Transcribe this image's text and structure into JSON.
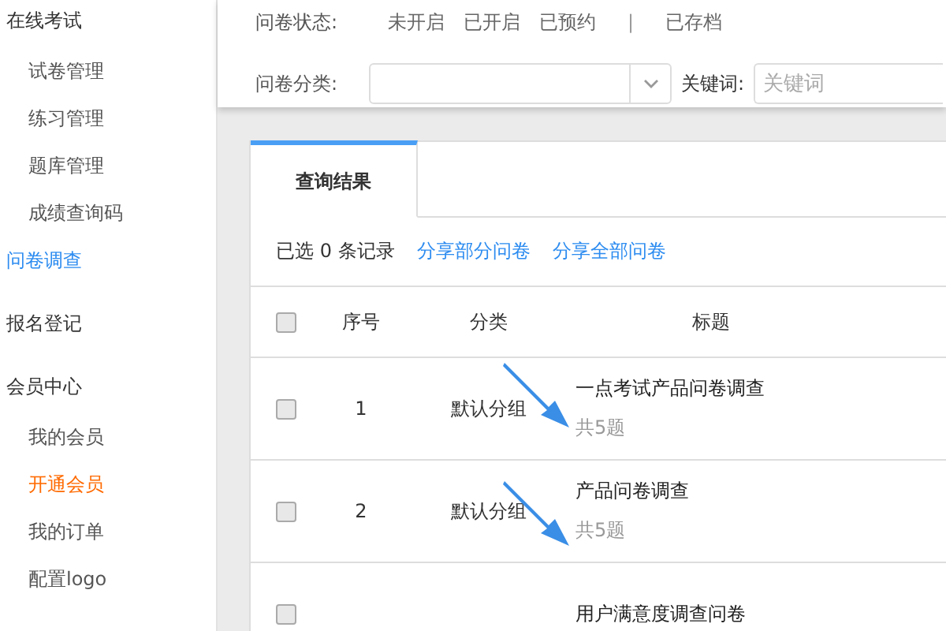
{
  "sidebar": {
    "groups": [
      {
        "label": "在线考试",
        "selected": false,
        "children": [
          {
            "label": "试卷管理",
            "selected": false,
            "highlight": false
          },
          {
            "label": "练习管理",
            "selected": false,
            "highlight": false
          },
          {
            "label": "题库管理",
            "selected": false,
            "highlight": false
          },
          {
            "label": "成绩查询码",
            "selected": false,
            "highlight": false
          }
        ]
      },
      {
        "label": "问卷调查",
        "selected": true
      },
      {
        "label": "报名登记",
        "selected": false
      },
      {
        "label": "会员中心",
        "selected": false,
        "children": [
          {
            "label": "我的会员",
            "selected": false,
            "highlight": false
          },
          {
            "label": "开通会员",
            "selected": false,
            "highlight": true
          },
          {
            "label": "我的订单",
            "selected": false,
            "highlight": false
          },
          {
            "label": "配置logo",
            "selected": false,
            "highlight": false
          }
        ]
      }
    ]
  },
  "filters": {
    "status_label": "问卷状态:",
    "statuses": [
      {
        "kind": "option",
        "label": "未开启"
      },
      {
        "kind": "option",
        "label": "已开启"
      },
      {
        "kind": "option",
        "label": "已预约"
      },
      {
        "kind": "divider",
        "label": "|"
      },
      {
        "kind": "option",
        "label": "已存档"
      }
    ],
    "category_label": "问卷分类:",
    "keyword_label": "关键词:",
    "keyword_placeholder": "关键词"
  },
  "tabs": [
    {
      "label": "查询结果",
      "selected": true
    }
  ],
  "toolbar": {
    "selected_count": "已选 0 条记录",
    "links": [
      "分享部分问卷",
      "分享全部问卷"
    ]
  },
  "table": {
    "select_all_checked": false,
    "columns": [
      "序号",
      "分类",
      "标题"
    ],
    "rows": [
      {
        "checked": false,
        "index": "1",
        "category": "默认分组",
        "title": "一点考试产品问卷调查",
        "count": "共5题"
      },
      {
        "checked": false,
        "index": "2",
        "category": "默认分组",
        "title": "产品问卷调查",
        "count": "共5题"
      },
      {
        "checked": false,
        "title": "用户满意度调查问卷"
      }
    ]
  }
}
